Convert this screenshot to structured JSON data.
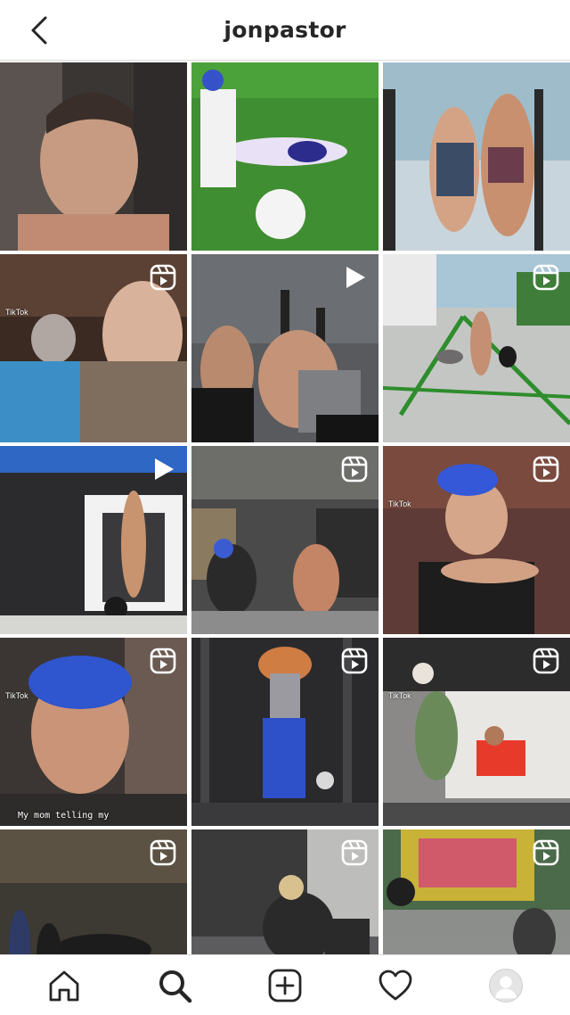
{
  "header": {
    "username": "jonpastor"
  },
  "icons": {
    "back": "chevron-left-icon",
    "reels": "reels-icon",
    "video": "play-icon",
    "home": "home-icon",
    "search": "search-icon",
    "new_post": "add-post-icon",
    "activity": "heart-icon",
    "profile": "avatar"
  },
  "colors": {
    "text": "#262626",
    "border": "#dbdbdb",
    "background": "#ffffff"
  },
  "grid": {
    "posts": [
      {
        "badge": "none",
        "caption": "",
        "tiktok": ""
      },
      {
        "badge": "none",
        "caption": "",
        "tiktok": ""
      },
      {
        "badge": "none",
        "caption": "",
        "tiktok": ""
      },
      {
        "badge": "reels",
        "caption": "",
        "tiktok": "TikTok"
      },
      {
        "badge": "video",
        "caption": "",
        "tiktok": ""
      },
      {
        "badge": "reels",
        "caption": "",
        "tiktok": ""
      },
      {
        "badge": "video",
        "caption": "",
        "tiktok": ""
      },
      {
        "badge": "reels",
        "caption": "",
        "tiktok": ""
      },
      {
        "badge": "reels",
        "caption": "",
        "tiktok": "TikTok"
      },
      {
        "badge": "reels",
        "caption": "My mom telling my",
        "tiktok": "TikTok"
      },
      {
        "badge": "reels",
        "caption": "",
        "tiktok": ""
      },
      {
        "badge": "reels",
        "caption": "",
        "tiktok": "TikTok"
      },
      {
        "badge": "reels",
        "caption": "",
        "tiktok": ""
      },
      {
        "badge": "reels",
        "caption": "",
        "tiktok": ""
      },
      {
        "badge": "reels",
        "caption": "",
        "tiktok": ""
      }
    ]
  },
  "tabbar": {
    "tabs": [
      "home",
      "search",
      "new-post",
      "activity",
      "profile"
    ],
    "active": "search"
  }
}
